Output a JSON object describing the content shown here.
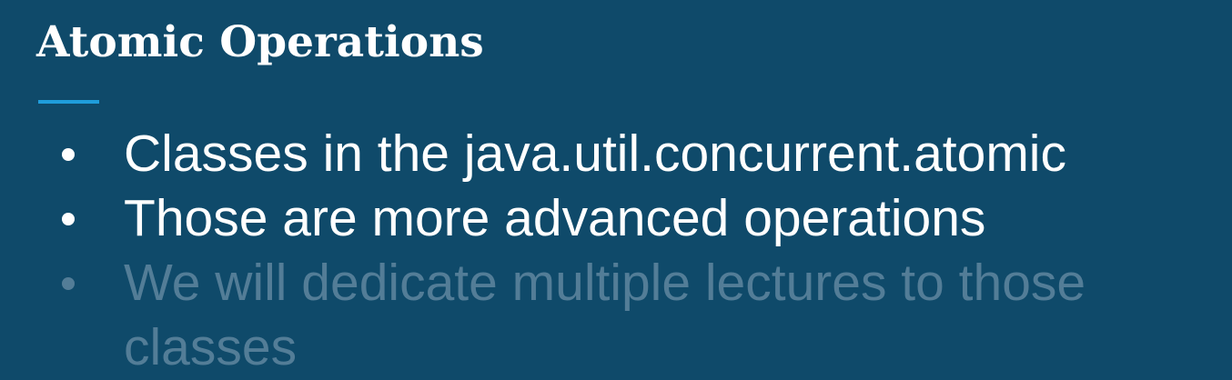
{
  "slide": {
    "title": "Atomic Operations",
    "accent_color": "#1f9ddb",
    "background_color": "#0f4a6a",
    "bullets": [
      {
        "text": "Classes in the java.util.concurrent.atomic",
        "state": "visible"
      },
      {
        "text": "Those are more advanced operations",
        "state": "visible"
      },
      {
        "text": "We will dedicate multiple lectures to those classes",
        "state": "dimmed"
      }
    ]
  }
}
